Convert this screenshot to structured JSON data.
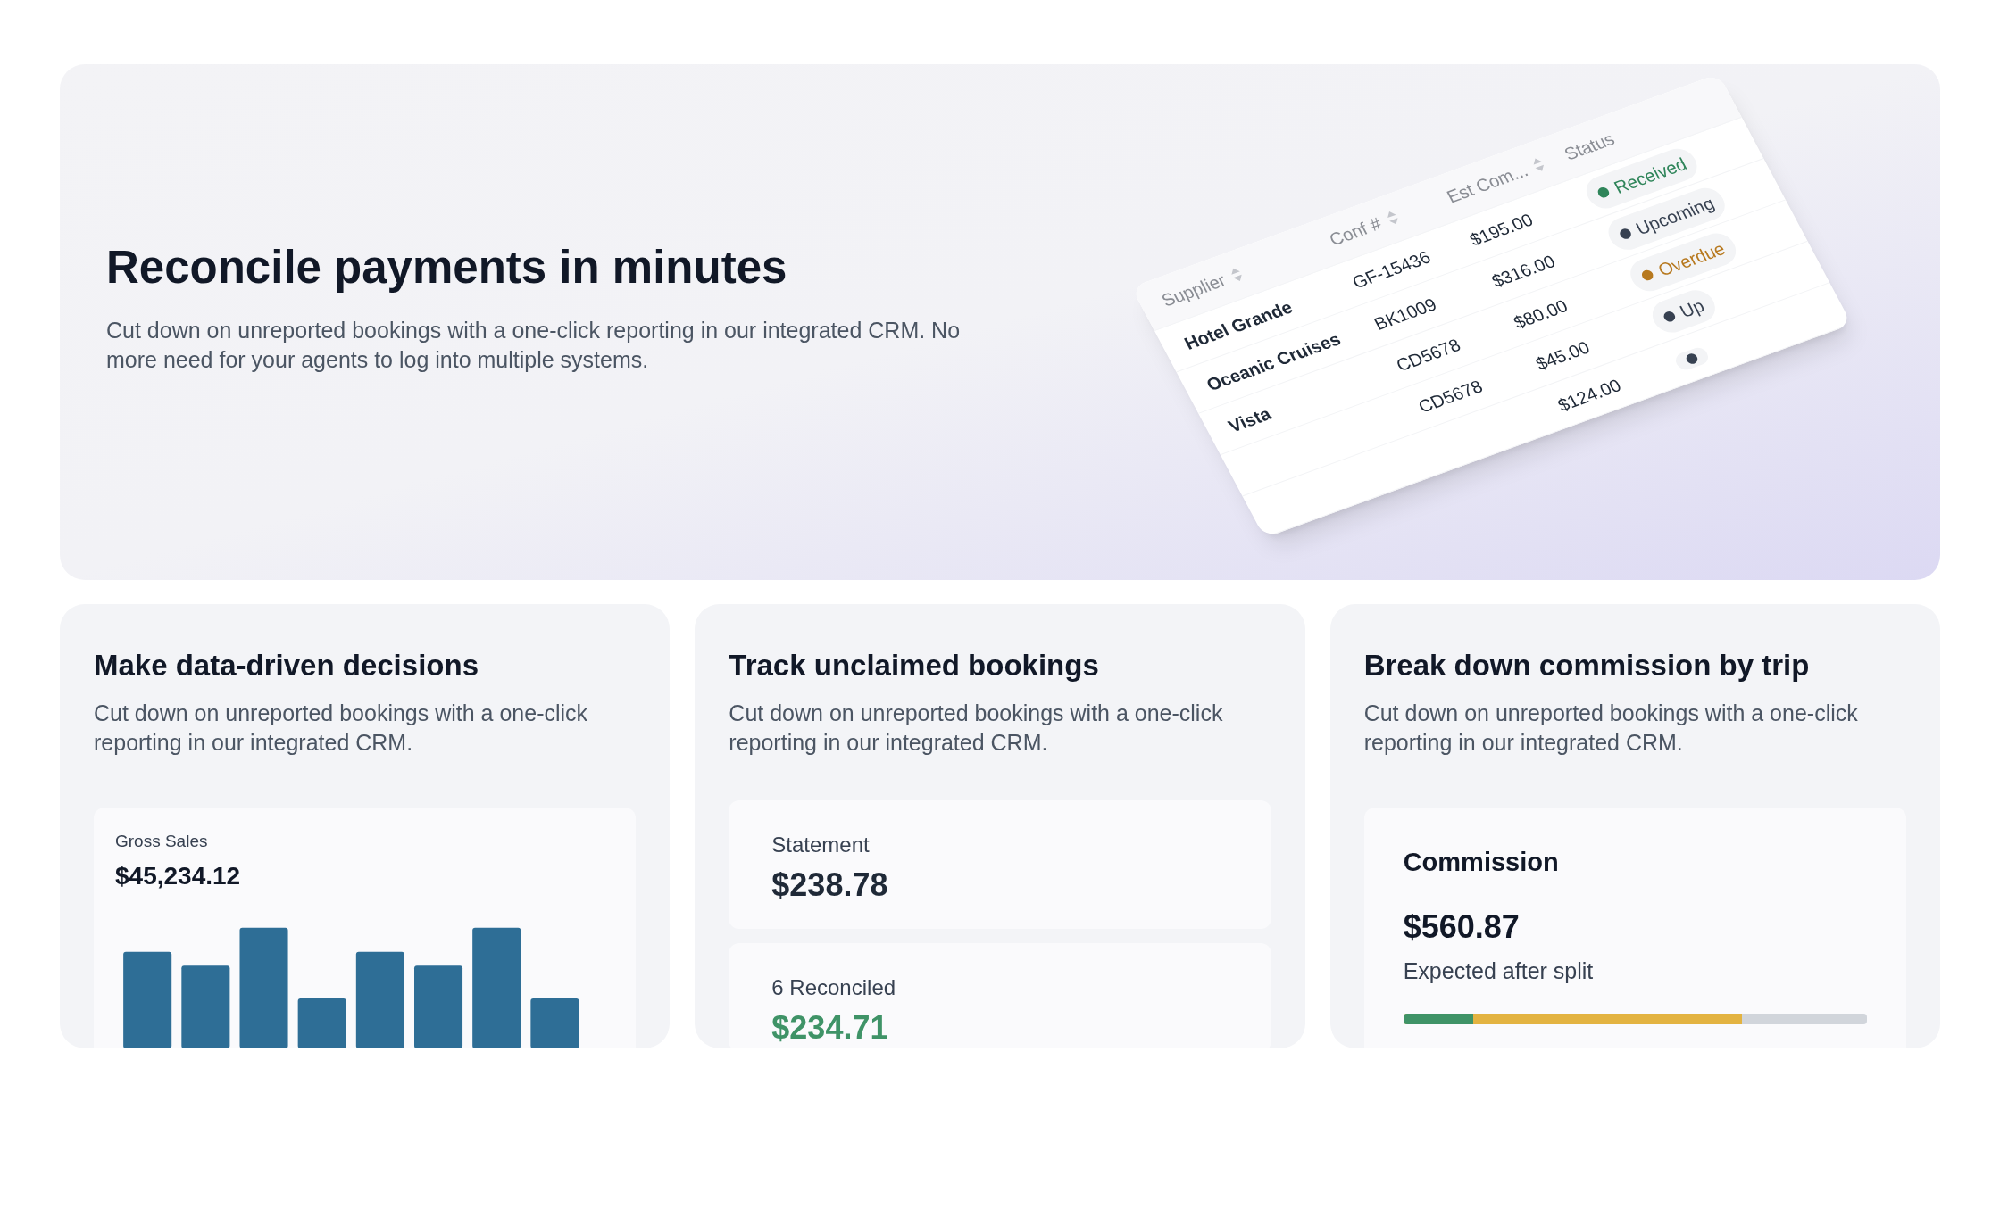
{
  "hero": {
    "title": "Reconcile payments in minutes",
    "body": "Cut down on unreported bookings with a one-click reporting in our integrated CRM. No more need for your agents to log into multiple systems.",
    "table": {
      "columns": [
        "Supplier",
        "Conf #",
        "Est Com...",
        "Status"
      ],
      "rows": [
        {
          "supplier": "Hotel Grande",
          "conf": "GF-15436",
          "amount": "$195.00",
          "status": {
            "label": "Received",
            "color": "#2f855a"
          }
        },
        {
          "supplier": "Oceanic Cruises",
          "conf": "BK1009",
          "amount": "$316.00",
          "status": {
            "label": "Upcoming",
            "color": "#374151"
          }
        },
        {
          "supplier": "Vista",
          "conf": "CD5678",
          "amount": "$80.00",
          "status": {
            "label": "Overdue",
            "color": "#b7791f"
          }
        },
        {
          "conf": "CD5678",
          "amount": "$45.00",
          "status": {
            "label": "Up",
            "color": "#374151"
          }
        },
        {
          "amount": "$124.00",
          "status": {
            "color": "#374151"
          }
        }
      ]
    }
  },
  "cards": [
    {
      "kind": "chart",
      "title": "Make data-driven decisions",
      "body": "Cut down on unreported bookings with a one-click reporting in our integrated CRM.",
      "label": "Gross Sales",
      "value": "$45,234.12"
    },
    {
      "kind": "statement",
      "title": "Track unclaimed bookings",
      "body": "Cut down on unreported bookings with a one-click reporting in our integrated CRM.",
      "items": [
        {
          "label": "Statement",
          "value": "$238.78",
          "color": "#1f2937"
        },
        {
          "label": "6 Reconciled",
          "value": "$234.71",
          "color": "#3f9367"
        }
      ]
    },
    {
      "kind": "progress",
      "title": "Break down commission by trip",
      "body": "Cut down on unreported bookings with a one-click reporting in our integrated CRM.",
      "label": "Commission",
      "value": "$560.87",
      "note": "Expected after split",
      "segments": [
        {
          "level": 0.15,
          "color": "#3f9367"
        },
        {
          "level": 0.73,
          "color": "#e3b341"
        }
      ]
    }
  ]
}
